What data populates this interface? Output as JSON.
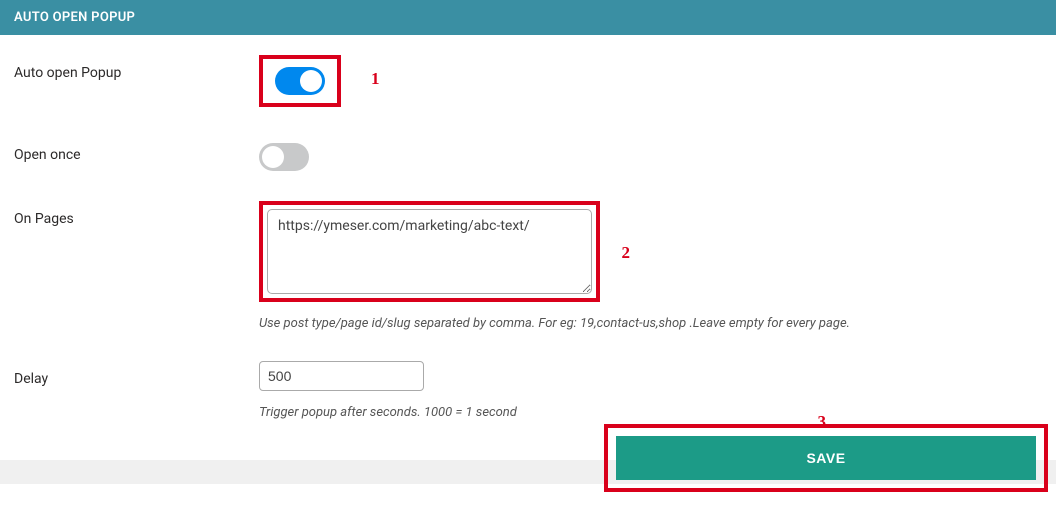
{
  "header": {
    "title": "AUTO OPEN POPUP"
  },
  "fields": {
    "auto_open": {
      "label": "Auto open Popup",
      "on": true
    },
    "open_once": {
      "label": "Open once",
      "on": false
    },
    "on_pages": {
      "label": "On Pages",
      "value": "https://ymeser.com/marketing/abc-text/",
      "hint": "Use post type/page id/slug separated by comma. For eg: 19,contact-us,shop .Leave empty for every page."
    },
    "delay": {
      "label": "Delay",
      "value": "500",
      "hint": "Trigger popup after seconds. 1000 = 1 second"
    }
  },
  "annotations": {
    "one": "1",
    "two": "2",
    "three": "3"
  },
  "actions": {
    "save": "SAVE"
  }
}
